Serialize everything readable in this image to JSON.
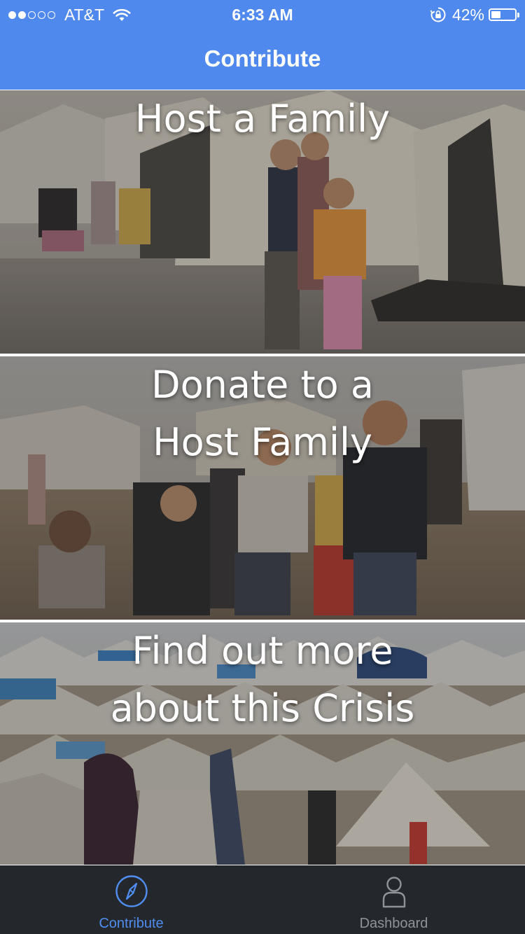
{
  "status_bar": {
    "signal_bars_on": 2,
    "signal_bars_total": 5,
    "carrier": "AT&T",
    "wifi_icon": "wifi-icon",
    "time": "6:33 AM",
    "rotation_lock_icon": "rotation-lock-icon",
    "battery_percent_label": "42%",
    "battery_level": 0.42
  },
  "nav": {
    "title": "Contribute",
    "bar_color": "#5089ee"
  },
  "cards": [
    {
      "title": "Host a Family",
      "image": "refugee children in front of tents"
    },
    {
      "title_line1": "Donate to a",
      "title_line2": "Host Family",
      "image": "children waving in refugee camp"
    },
    {
      "title_line1": "Find out more",
      "title_line2": "about this Crisis",
      "image": "refugee camp tents"
    }
  ],
  "tabbar": {
    "tabs": [
      {
        "label": "Contribute",
        "icon": "compass-icon",
        "active": true
      },
      {
        "label": "Dashboard",
        "icon": "person-icon",
        "active": false
      }
    ],
    "active_color": "#4f8df0",
    "inactive_color": "#8f9398",
    "background": "#24282c"
  }
}
